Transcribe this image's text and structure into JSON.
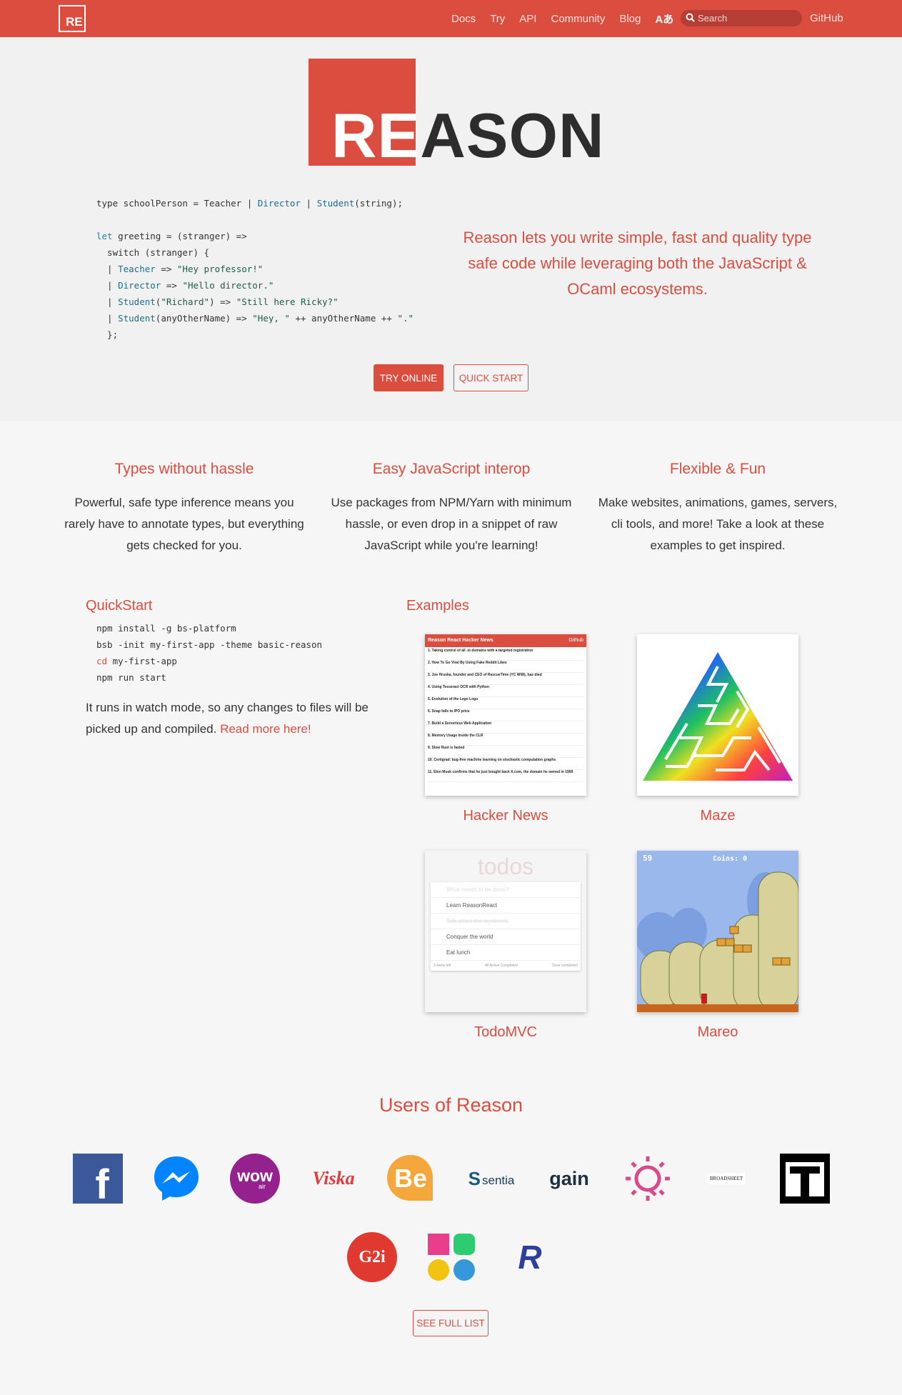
{
  "nav": {
    "logo": "RE",
    "links": [
      "Docs",
      "Try",
      "API",
      "Community",
      "Blog"
    ],
    "translate_label": "Aあ",
    "search_placeholder": "Search",
    "github": "GitHub"
  },
  "hero": {
    "logo_re": "RE",
    "logo_ason": "ASON",
    "tagline": "Reason lets you write simple, fast and quality type safe code while leveraging both the JavaScript & OCaml ecosystems.",
    "try_online": "TRY ONLINE",
    "quick_start": "QUICK START"
  },
  "features": [
    {
      "title": "Types without hassle",
      "text": "Powerful, safe type inference means you rarely have to annotate types, but everything gets checked for you."
    },
    {
      "title": "Easy JavaScript interop",
      "text": "Use packages from NPM/Yarn with minimum hassle, or even drop in a snippet of raw JavaScript while you're learning!"
    },
    {
      "title": "Flexible & Fun",
      "text": "Make websites, animations, games, servers, cli tools, and more! Take a look at these examples to get inspired."
    }
  ],
  "quickstart": {
    "title": "QuickStart",
    "lines": [
      "npm install -g bs-platform",
      "bsb -init my-first-app -theme basic-reason",
      "my-first-app",
      "npm run start"
    ],
    "cd_keyword": "cd",
    "text": "It runs in watch mode, so any changes to files will be picked up and compiled. ",
    "link": "Read more here!"
  },
  "examples": {
    "title": "Examples",
    "items": [
      {
        "label": "Hacker News"
      },
      {
        "label": "Maze"
      },
      {
        "label": "TodoMVC"
      },
      {
        "label": "Mareo"
      }
    ],
    "hn_header": "Reason React Hacker News",
    "hn_github": "Github",
    "hn_stories": [
      "1. Taking control of all .io domains with a targeted registration",
      "2. How To Go Viral By Using Fake Reddit Likes",
      "3. Joe Hruska, founder and CEO of RescueTime (YC W08), has died",
      "4. Using Tesseract OCR with Python",
      "5. Evolution of the Lego Logo",
      "6. Snap falls to IPO price",
      "7. Build a Serverless Web Application",
      "8. Memory Usage Inside the CLR",
      "9. Slow Rust is fasted",
      "10. Certigrad: bug-free machine learning on stochastic computation graphs",
      "11. Elon Musk confirms that he just bought back X.com, the domain he owned in 1999"
    ],
    "todo_title": "todos",
    "todo_placeholder": "What needs to be done?",
    "todo_items": [
      "Learn ReasonReact",
      "Talk about the mysteries",
      "Conquer the world",
      "Eat lunch"
    ],
    "todo_footer_left": "3 items left",
    "todo_footer_filters": [
      "All",
      "Active",
      "Completed"
    ],
    "todo_footer_right": "Clear completed",
    "mareo_score": "59",
    "mareo_coins": "Coins: 0"
  },
  "users": {
    "title": "Users of Reason",
    "logos": [
      "facebook-icon",
      "messenger-icon",
      "wow-air-icon",
      "viska-icon",
      "behance-icon",
      "sentia-icon",
      "gain-icon",
      "bell-bubble-icon",
      "broadsheet-icon",
      "t-icon",
      "g2i-icon",
      "flower-icon",
      "r-icon"
    ],
    "viska": "Viska",
    "be": "Be",
    "sentia": "sentia",
    "gain": "gain",
    "broadsheet": "BROADSHEET",
    "g2i": "G2i",
    "wow": "wow",
    "wow_air": "air",
    "see_full_list": "SEE FULL LIST"
  },
  "colors": {
    "brand": "#db4d3f",
    "text": "#333333"
  }
}
